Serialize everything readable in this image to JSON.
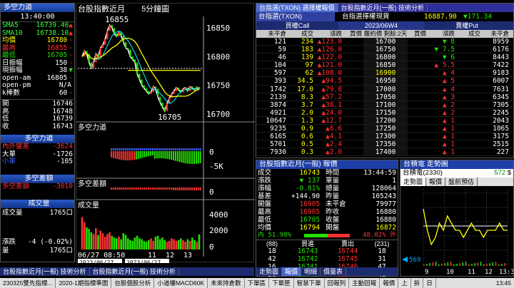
{
  "left_panel": {
    "title": "多空力道",
    "time": "13:40:00",
    "sma5": {
      "label": "SMA5",
      "value": "16739.40",
      "arrow": "▲"
    },
    "sma10": {
      "label": "SMA10",
      "value": "16738.10",
      "arrow": "▲"
    },
    "stats": [
      {
        "label": "均價",
        "value": "16780",
        "cls": "yel",
        "sfx": "-"
      },
      {
        "label": "最高",
        "value": "16855",
        "cls": "red",
        "sfx": "-"
      },
      {
        "label": "最低",
        "value": "16705",
        "cls": "grn",
        "sfx": "-"
      },
      {
        "label": "日振幅",
        "value": "150",
        "cls": "wht",
        "sfx": "-"
      },
      {
        "label": "現振幅",
        "value": "38",
        "cls": "wht",
        "sfx": "▼"
      },
      {
        "label": "open-am",
        "value": "16805",
        "cls": "wht",
        "sfx": "-"
      },
      {
        "label": "open-pm",
        "value": "N/A",
        "cls": "wht",
        "sfx": ""
      },
      {
        "label": "k棒數",
        "value": "60",
        "cls": "wht",
        "sfx": "-"
      }
    ],
    "ohlc": [
      {
        "label": "開",
        "value": "16746"
      },
      {
        "label": "高",
        "value": "16748"
      },
      {
        "label": "低",
        "value": "16739"
      },
      {
        "label": "收",
        "value": "16743"
      }
    ],
    "power_title": "多空力道",
    "power": [
      {
        "label": "內外盤差",
        "value": "-3624",
        "cls": "red"
      },
      {
        "label": "大單",
        "value": "-1726",
        "cls": "wht"
      },
      {
        "label": "小單",
        "value": "-105",
        "cls": "wht"
      }
    ],
    "diff_title": "多空差額",
    "diff": {
      "label": "多空差額",
      "value": "-3010"
    },
    "vol_title": "成交量",
    "vol": {
      "label": "成交量",
      "value": "1765口"
    },
    "change": {
      "label": "漲跌",
      "value": "-4 (-0.02%)"
    },
    "qty": {
      "label": "量",
      "value": "1765口"
    }
  },
  "chart": {
    "title": "台股指數近月",
    "period": "5分鐘圖",
    "price_axis": [
      "16850",
      "16800",
      "16750",
      "16700"
    ],
    "high_label": "16855",
    "low_label": "16705",
    "power_label": "多空力道",
    "power_axis": [
      "0",
      "-5K"
    ],
    "diff_label": "多空差額",
    "diff_axis": [
      "0"
    ],
    "vol_label": "成交量",
    "vol_axis": [
      "4000",
      "2000",
      "0"
    ],
    "time_axis": [
      "06/27 08:50",
      "11",
      "12",
      "13"
    ],
    "date_from": "2023/06/27",
    "date_to": "2023/06/27"
  },
  "options": {
    "tabs": [
      "台指選(TXON) 選擇權報價",
      "台股指數近月(一般) 技術分析"
    ],
    "sym": "台指選(TXON)",
    "spot_label": "台指選擇權現貨",
    "spot_value": "16887.90",
    "spot_change": "▼171.34",
    "call": "買權Call",
    "month": "2023/06W4",
    "put": "賣權Put",
    "headers_left": [
      "未平倉",
      "成交",
      "漲跌",
      "買價"
    ],
    "strike_header": "履約價 剩餘:2天",
    "headers_right": [
      "買價",
      "漲跌",
      "成交",
      "未平倉"
    ],
    "rows": [
      {
        "l": [
          "121",
          "234",
          "▲123.0",
          ""
        ],
        "s": "16700",
        "r": [
          "",
          "▼ 8",
          "",
          "8959"
        ]
      },
      {
        "l": [
          "59",
          "183",
          "▲126.0",
          ""
        ],
        "s": "16750",
        "r": [
          "",
          "▼ 7.5",
          "",
          "6176"
        ]
      },
      {
        "l": [
          "46",
          "139",
          "▲122.0",
          ""
        ],
        "s": "16800",
        "r": [
          "",
          "▼ 6",
          "",
          "8443"
        ]
      },
      {
        "l": [
          "104",
          "97",
          "▲121.0",
          ""
        ],
        "s": "16850",
        "r": [
          "",
          "▲ 5.5",
          "",
          "7422"
        ]
      },
      {
        "l": [
          "597",
          "62",
          "▲108.0",
          ""
        ],
        "s": "16900",
        "r": [
          "",
          "▲ 4",
          "",
          "9183"
        ]
      },
      {
        "l": [
          "393",
          "34.5",
          "▲94.5",
          ""
        ],
        "s": "16950",
        "r": [
          "",
          "▲ 5",
          "",
          "6007"
        ]
      },
      {
        "l": [
          "1742",
          "17.0",
          "▲79.0",
          ""
        ],
        "s": "17000",
        "r": [
          "",
          "▲ 4",
          "",
          "7631"
        ]
      },
      {
        "l": [
          "2139",
          "8.3",
          "▲57.2",
          ""
        ],
        "s": "17050",
        "r": [
          "",
          "▲ 3",
          "",
          "6345"
        ]
      },
      {
        "l": [
          "3874",
          "3.7",
          "▲38.1",
          ""
        ],
        "s": "17100",
        "r": [
          "",
          "▲ 2",
          "",
          "7305"
        ]
      },
      {
        "l": [
          "4921",
          "2.0",
          "▲24.0",
          ""
        ],
        "s": "17150",
        "r": [
          "",
          "▲ 2",
          "",
          "2245"
        ]
      },
      {
        "l": [
          "10647",
          "1.3",
          "▲12.7",
          ""
        ],
        "s": "17200",
        "r": [
          "",
          "▲ 1",
          "",
          "2043"
        ]
      },
      {
        "l": [
          "9235",
          "0.9",
          "▲6.6",
          ""
        ],
        "s": "17250",
        "r": [
          "",
          "▲ 1",
          "",
          "1065"
        ]
      },
      {
        "l": [
          "6165",
          "0.6",
          "▲4.1",
          ""
        ],
        "s": "17300",
        "r": [
          "",
          "▲ 1",
          "",
          "3175"
        ]
      },
      {
        "l": [
          "5701",
          "0.5",
          "▲2.4",
          ""
        ],
        "s": "17350",
        "r": [
          "",
          "▲ 1",
          "",
          "2515"
        ]
      },
      {
        "l": [
          "7930",
          "0.3",
          "▲2.0",
          ""
        ],
        "s": "17400",
        "r": [
          "",
          "▲ 1",
          "",
          "227"
        ]
      }
    ]
  },
  "quote": {
    "title": "台股指數近月(一般) 報價",
    "time": "13:44:59",
    "lines": [
      {
        "a": "成交",
        "b": "16743",
        "c": "時間",
        "d": ""
      },
      {
        "a": "漲跌",
        "b": "▼ 137",
        "c": "單量",
        "d": "1"
      },
      {
        "a": "漲幅",
        "b": "-0.81%",
        "c": "總量",
        "d": "128064"
      },
      {
        "a": "基差",
        "b": "+144.90",
        "c": "昨量",
        "d": "105243"
      },
      {
        "a": "開盤",
        "b": "16905",
        "c": "未平倉",
        "d": "79977"
      },
      {
        "a": "最高",
        "b": "16905",
        "c": "昨收",
        "d": "16880"
      },
      {
        "a": "最低",
        "b": "16705",
        "c": "收盤",
        "d": "16880"
      },
      {
        "a": "均價",
        "b": "16794",
        "c": "開盤",
        "d": "16872"
      }
    ],
    "ratio_in": "內 51.98%",
    "ratio_out": "48.02% 外",
    "ratio": 51.98,
    "book_hdr": [
      "(88)",
      "買進",
      "賣出",
      "(231)"
    ],
    "book": [
      {
        "a": "18",
        "b": "16743",
        "c": "16744",
        "d": "18"
      },
      {
        "a": "42",
        "b": "16742",
        "c": "16745",
        "d": "31"
      },
      {
        "a": "16",
        "b": "16741",
        "c": "16746",
        "d": "47"
      },
      {
        "a": "21",
        "b": "16740",
        "c": "16747",
        "d": "42"
      },
      {
        "a": "20",
        "b": "16739",
        "c": "16748",
        "d": "46"
      }
    ],
    "tabs": [
      "走勢圖",
      "報價",
      "明細",
      "價量表"
    ]
  },
  "stock": {
    "title": "台積電 走勢圖",
    "name": "台積電(2330)",
    "price": "572",
    "arrow": "$",
    "tabs": [
      "走勢圖",
      "報價",
      "盤前預估"
    ],
    "low_label": "569",
    "time_axis": [
      "9",
      "10",
      "11",
      "12",
      "13:30"
    ]
  },
  "bottom_tabs": [
    "台股指數近月(一般) 技術分析",
    "台股指數近月(一般) 技術分析"
  ],
  "taskbar": {
    "items": [
      "230325雙先指標...",
      "2020-1期指標準圖",
      "台股個股分析",
      "小道樓MACD60K",
      "未來持倉數",
      "下單區",
      "下單匣",
      "智慧下單",
      "回報列",
      "主動回報",
      "報價",
      "上",
      "拆",
      "日"
    ],
    "clock": "13:45"
  },
  "colors": {
    "up": "#ff3030",
    "down": "#22e000",
    "price_line": "#ffffff",
    "ma_line": "#ffff00",
    "bg": "#000000"
  }
}
